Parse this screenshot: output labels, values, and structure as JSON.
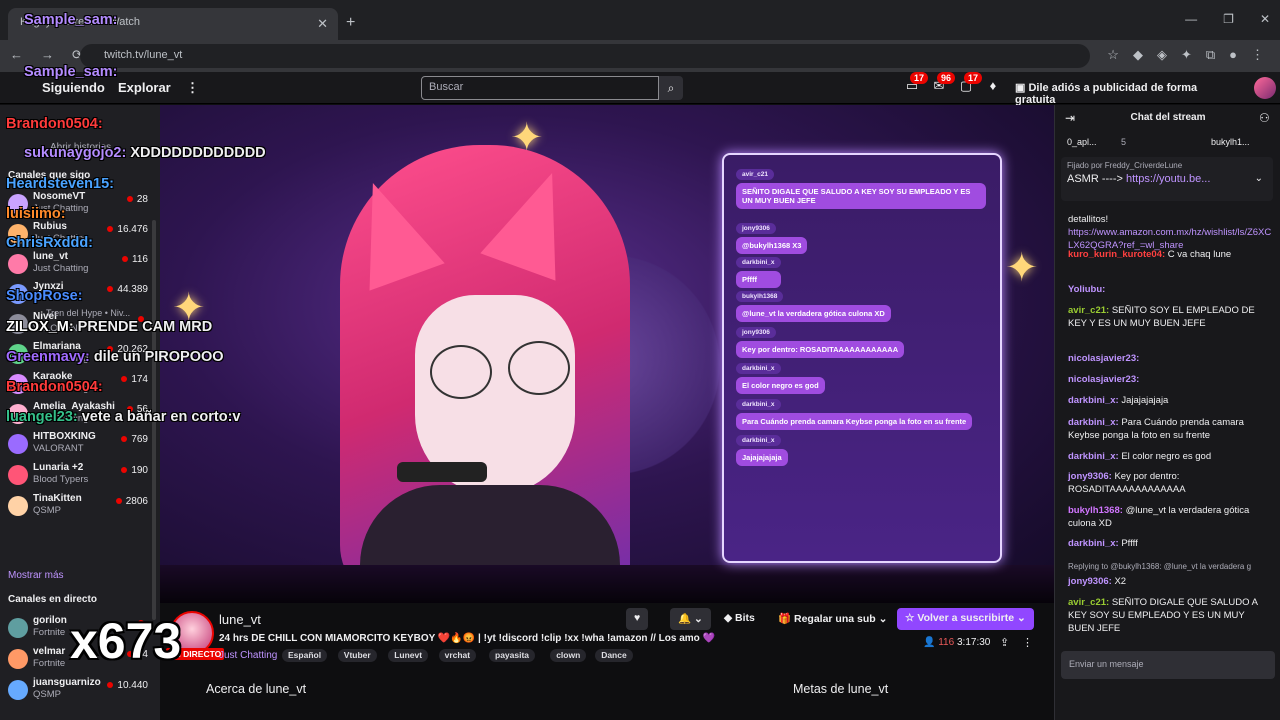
{
  "browser": {
    "tab_title": "Kagoyoz stream - Watch",
    "url": "twitch.tv/lune_vt",
    "new_tab": "+",
    "back": "←",
    "forward": "→",
    "reload": "⟳",
    "star": "☆",
    "win_min": "—",
    "win_max": "❐",
    "win_close": "✕"
  },
  "topnav": {
    "following": "Siguiendo",
    "explore": "Explorar",
    "more": "⋮",
    "search_placeholder": "Buscar",
    "search_icon": "⌕",
    "notif_badges": [
      "17",
      "96",
      "17"
    ],
    "ad_free": "Dile adiós a publicidad de forma gratuita"
  },
  "sidebar": {
    "section_followed": "Canales que sigo",
    "section_direct": "Canales en directo",
    "show_more": "Mostrar más",
    "stories": "Abrir historias",
    "hype": "Tren del Hype • Niv...",
    "channels": [
      {
        "name": "NosomeVT",
        "game": "Just Chatting",
        "viewers": "28",
        "color": "#c9a3ff"
      },
      {
        "name": "Rubius",
        "game": "Just Chatting",
        "viewers": "16.476",
        "color": "#ffb36b"
      },
      {
        "name": "lune_vt",
        "game": "Just Chatting",
        "viewers": "116",
        "color": "#ff7aa8"
      },
      {
        "name": "Jynxzi",
        "game": "",
        "viewers": "44.389",
        "color": "#7a9aff"
      },
      {
        "name": "Nivel",
        "game": "VALORANT",
        "viewers": "",
        "color": "#8c8c9a"
      },
      {
        "name": "Elmariana",
        "game": "Just Chatting",
        "viewers": "20.262",
        "color": "#5fd38a"
      },
      {
        "name": "Karaoke",
        "game": "Just Chatting",
        "viewers": "174",
        "color": "#d88bff"
      },
      {
        "name": "Amelia_Ayakashi",
        "game": "Just Chatting",
        "viewers": "56",
        "color": "#ffb0d0"
      },
      {
        "name": "HITBOXKING",
        "game": "VALORANT",
        "viewers": "769",
        "color": "#9a6bff"
      },
      {
        "name": "Lunaria +2",
        "game": "Blood Typers",
        "viewers": "190",
        "color": "#ff5577"
      },
      {
        "name": "TinaKitten",
        "game": "QSMP",
        "viewers": "2806",
        "color": "#ffd2a6"
      }
    ],
    "direct": [
      {
        "name": "gorilon",
        "game": "Fortnite",
        "viewers": "",
        "color": "#5f9ea0"
      },
      {
        "name": "velmar",
        "game": "Fortnite",
        "viewers": "14",
        "color": "#ff9966"
      },
      {
        "name": "juansguarnizo",
        "game": "QSMP",
        "viewers": "10.440",
        "color": "#66aaff"
      }
    ]
  },
  "overlay_chat": [
    {
      "user": "Sample_sam:",
      "text": "",
      "color": "#b48cff"
    },
    {
      "user": "Sample_sam:",
      "text": "",
      "color": "#b48cff"
    },
    {
      "user": "Brandon0504:",
      "text": "",
      "color": "#ff3b3b"
    },
    {
      "user": "sukunaygojo2:",
      "text": "XDDDDDDDDDDDD",
      "color": "#b48cff"
    },
    {
      "user": "Heardsteven15:",
      "text": "",
      "color": "#4aa3ff"
    },
    {
      "user": "luisiimo:",
      "text": "",
      "color": "#ff8a2b"
    },
    {
      "user": "ChrisRxddd:",
      "text": "",
      "color": "#4aa3ff"
    },
    {
      "user": "ShopRose:",
      "text": "",
      "color": "#4a8cff"
    },
    {
      "user": "ZILOX_M:",
      "text": "PRENDE CAM MRD",
      "color": "#ffffff"
    },
    {
      "user": "Greenmavy:",
      "text": "dile un PIROPOOO",
      "color": "#a06bff"
    },
    {
      "user": "Brandon0504:",
      "text": "",
      "color": "#ff3b3b"
    },
    {
      "user": "luangel23:",
      "text": "vete a bañar en corto:v",
      "color": "#35c08a"
    }
  ],
  "overlay_count": "x673",
  "video_chat": [
    {
      "user": "avir_c21",
      "text": "SEÑITO DIGALE QUE SALUDO A KEY SOY SU EMPLEADO Y ES UN MUY BUEN JEFE"
    },
    {
      "user": "jony9306",
      "text": "@bukylh1368 X3"
    },
    {
      "user": "darkbini_x",
      "text": "Pffff"
    },
    {
      "user": "bukylh1368",
      "text": "@lune_vt la verdadera gótica culona XD"
    },
    {
      "user": "jony9306",
      "text": "Key por dentro: ROSADITAAAAAAAAAAAA"
    },
    {
      "user": "darkbini_x",
      "text": "El color negro es god"
    },
    {
      "user": "darkbini_x",
      "text": "Para Cuándo prenda camara Keybse ponga la foto en su frente"
    },
    {
      "user": "darkbini_x",
      "text": "Jajajajajaja"
    }
  ],
  "stream": {
    "streamer": "lune_vt",
    "live": "EN DIRECTO",
    "title": "24 hrs DE CHILL CON MIAMORCITO KEYBOY ❤️🔥😡 | !yt !discord !clip !xx !wha !amazon // Los amo 💜",
    "category": "Just Chatting",
    "tags": [
      "Español",
      "Vtuber",
      "Lunevt",
      "vrchat",
      "payasita",
      "clown",
      "Dance"
    ],
    "bits": "Bits",
    "gift": "Regalar una sub",
    "subscribe": "Volver a suscribirte",
    "viewers": "116",
    "uptime": "3:17:30",
    "about": "Acerca de lune_vt",
    "goals": "Metas de lune_vt"
  },
  "chat": {
    "header": "Chat del stream",
    "gift_left": "0_apl...",
    "gift_left_count": "5",
    "gift_right": "bukylh1...",
    "pinned_by": "Fijado por Freddy_CriverdeLune",
    "pinned_text": "ASMR ---->",
    "pinned_link": "https://youtu.be...",
    "input_placeholder": "Enviar un mensaje",
    "messages": [
      {
        "user": "",
        "text": "detallitos!",
        "color": "#efeff1"
      },
      {
        "user": "",
        "text": "https://www.amazon.com.mx/hz/wishlist/ls/Z6XCLX62QGRA?ref_=wl_share",
        "color": "#bf94ff"
      },
      {
        "user": "kuro_kurin_kurote04:",
        "text": "C va chaq lune",
        "color": "#ff4040"
      },
      {
        "user": "Yoliubu:",
        "text": "",
        "color": "#bf94ff"
      },
      {
        "user": "avir_c21:",
        "text": "SEÑITO SOY EL EMPLEADO DE KEY Y ES UN MUY BUEN JEFE",
        "color": "#9acd32"
      },
      {
        "user": "nicolasjavier23:",
        "text": "",
        "color": "#bf94ff"
      },
      {
        "user": "nicolasjavier23:",
        "text": "",
        "color": "#bf94ff"
      },
      {
        "user": "darkbini_x:",
        "text": "Jajajajajaja",
        "color": "#bf94ff"
      },
      {
        "user": "darkbini_x:",
        "text": "Para Cuándo prenda camara Keybse ponga la foto en su frente",
        "color": "#bf94ff"
      },
      {
        "user": "darkbini_x:",
        "text": "El color negro es god",
        "color": "#bf94ff"
      },
      {
        "user": "jony9306:",
        "text": "Key por dentro: ROSADITAAAAAAAAAAAA",
        "color": "#bf94ff"
      },
      {
        "user": "bukylh1368:",
        "text": "@lune_vt la verdadera gótica culona XD",
        "color": "#d176ff"
      },
      {
        "user": "darkbini_x:",
        "text": "Pffff",
        "color": "#bf94ff"
      },
      {
        "user": "",
        "text": "Replying to @bukylh1368: @lune_vt la verdadera g",
        "color": "#adadb8"
      },
      {
        "user": "jony9306:",
        "text": "X2",
        "color": "#bf94ff"
      },
      {
        "user": "avir_c21:",
        "text": "SEÑITO DIGALE QUE SALUDO A KEY SOY SU EMPLEADO Y ES UN MUY BUEN JEFE",
        "color": "#9acd32"
      }
    ]
  }
}
